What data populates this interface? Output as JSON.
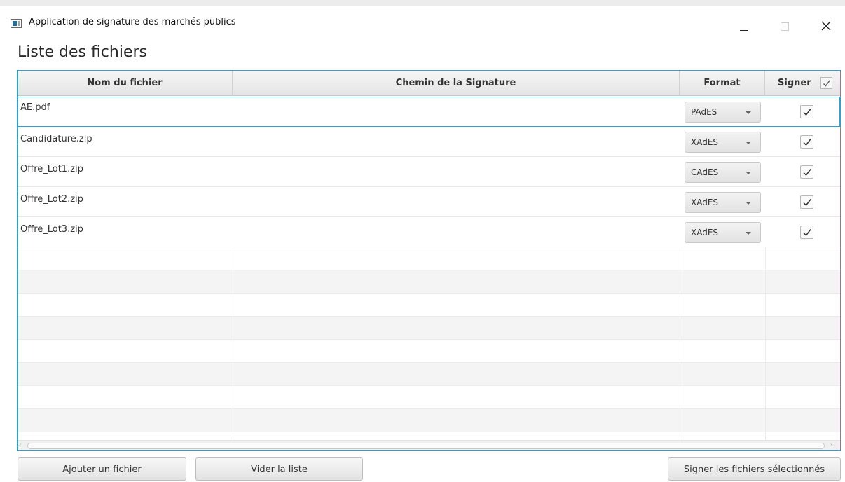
{
  "window": {
    "title": "Application de signature des marchés publics"
  },
  "page": {
    "heading": "Liste des fichiers"
  },
  "table": {
    "columns": {
      "name": "Nom du fichier",
      "path": "Chemin de la Signature",
      "format": "Format",
      "sign": "Signer"
    },
    "sign_all_checked": true,
    "rows": [
      {
        "name": "AE.pdf",
        "path": "",
        "format": "PAdES",
        "checked": true,
        "selected": true
      },
      {
        "name": "Candidature.zip",
        "path": "",
        "format": "XAdES",
        "checked": true,
        "selected": false
      },
      {
        "name": "Offre_Lot1.zip",
        "path": "",
        "format": "CAdES",
        "checked": true,
        "selected": false
      },
      {
        "name": "Offre_Lot2.zip",
        "path": "",
        "format": "XAdES",
        "checked": true,
        "selected": false
      },
      {
        "name": "Offre_Lot3.zip",
        "path": "",
        "format": "XAdES",
        "checked": true,
        "selected": false
      }
    ]
  },
  "buttons": {
    "add": "Ajouter un fichier",
    "clear": "Vider la liste",
    "sign_selected": "Signer les fichiers sélectionnés"
  },
  "icons": {
    "app": "app-window-icon",
    "minimize": "minimize-icon",
    "maximize": "maximize-icon",
    "close": "close-icon",
    "check": "check-icon",
    "dropdown": "chevron-down-icon"
  },
  "colors": {
    "accent": "#2aa0d4"
  }
}
